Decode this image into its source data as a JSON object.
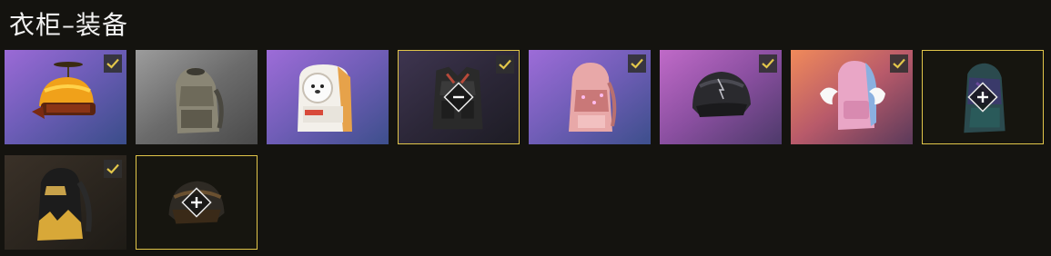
{
  "title": "衣柜–装备",
  "colors": {
    "background": "#14130f",
    "selected_border": "#e2c64a",
    "check_mark": "#e2c64a"
  },
  "slots": [
    {
      "name": "jetpack-helmet",
      "icon": "orange-propeller-helmet-icon",
      "checked": true,
      "selected": false,
      "action": null
    },
    {
      "name": "gray-backpack",
      "icon": "gray-tactical-backpack-icon",
      "checked": false,
      "selected": false,
      "action": null
    },
    {
      "name": "dog-carrier-backpack",
      "icon": "pet-carrier-backpack-icon",
      "checked": false,
      "selected": false,
      "action": null
    },
    {
      "name": "tactical-vest",
      "icon": "tactical-vest-icon",
      "checked": true,
      "selected": true,
      "action": "remove"
    },
    {
      "name": "pink-sequin-backpack",
      "icon": "pink-backpack-icon",
      "checked": true,
      "selected": false,
      "action": null
    },
    {
      "name": "black-tactical-helmet",
      "icon": "black-helmet-icon",
      "checked": true,
      "selected": false,
      "action": null
    },
    {
      "name": "winged-pink-backpack",
      "icon": "winged-backpack-icon",
      "checked": true,
      "selected": false,
      "action": null
    },
    {
      "name": "dark-teal-backpack",
      "icon": "dark-backpack-icon",
      "checked": false,
      "selected": true,
      "action": "add"
    },
    {
      "name": "black-gold-backpack",
      "icon": "black-gold-backpack-icon",
      "checked": true,
      "selected": false,
      "action": null
    },
    {
      "name": "dark-helmet",
      "icon": "dark-helmet-icon",
      "checked": false,
      "selected": true,
      "action": "add"
    }
  ]
}
